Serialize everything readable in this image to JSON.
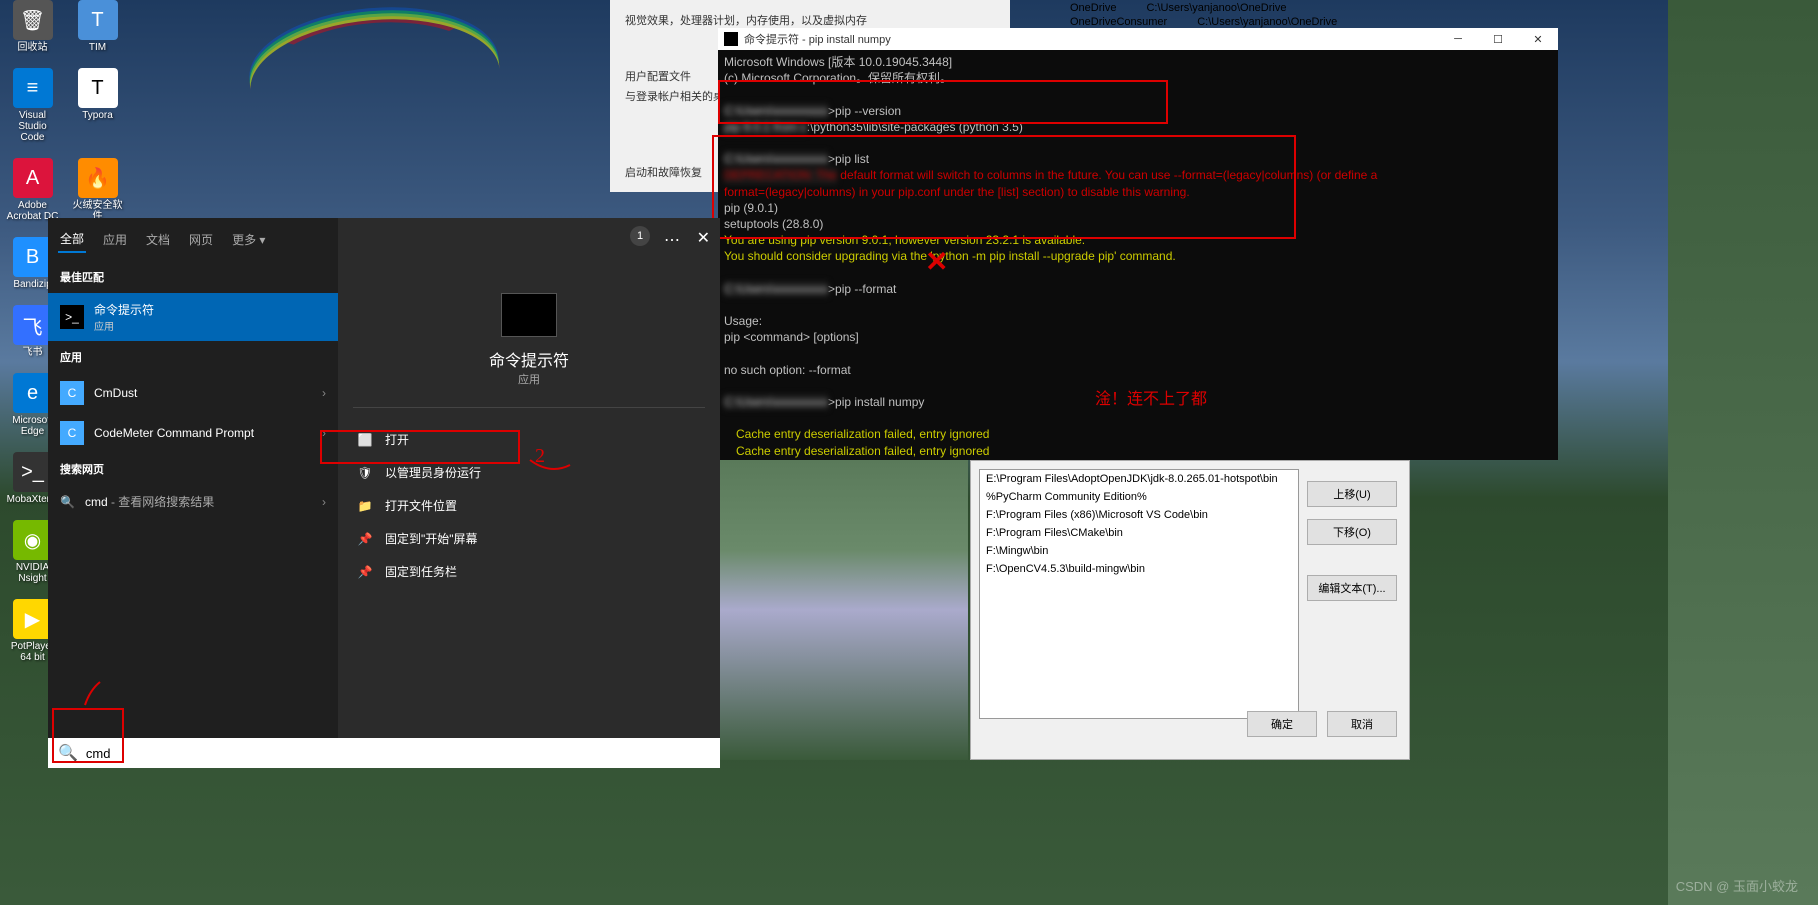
{
  "desktop": {
    "icons": [
      {
        "label": "回收站"
      },
      {
        "label": "TIM"
      },
      {
        "label": "Visual Studio Code"
      },
      {
        "label": "Typora"
      },
      {
        "label": "Adobe Acrobat DC"
      },
      {
        "label": "火绒安全软件"
      },
      {
        "label": "Bandizip"
      },
      {
        "label": ""
      },
      {
        "label": "飞书"
      },
      {
        "label": ""
      },
      {
        "label": "Microsoft Edge"
      },
      {
        "label": ""
      },
      {
        "label": "MobaXterm"
      },
      {
        "label": ""
      },
      {
        "label": "NVIDIA Nsight"
      },
      {
        "label": ""
      },
      {
        "label": "PotPlayer 64 bit"
      },
      {
        "label": ""
      }
    ]
  },
  "start_menu": {
    "tabs": {
      "all": "全部",
      "apps": "应用",
      "docs": "文档",
      "web": "网页",
      "more": "更多"
    },
    "badge": "1",
    "sections": {
      "best_match": "最佳匹配",
      "apps": "应用",
      "web": "搜索网页"
    },
    "best_item": {
      "title": "命令提示符",
      "sub": "应用"
    },
    "app_items": [
      {
        "title": "CmDust"
      },
      {
        "title": "CodeMeter Command Prompt"
      }
    ],
    "web_item": {
      "prefix": "cmd",
      "suffix": " - 查看网络搜索结果"
    },
    "preview": {
      "title": "命令提示符",
      "sub": "应用"
    },
    "actions": {
      "open": "打开",
      "admin": "以管理员身份运行",
      "location": "打开文件位置",
      "pin_start": "固定到\"开始\"屏幕",
      "pin_taskbar": "固定到任务栏"
    },
    "search_value": "cmd"
  },
  "sysprops": {
    "line1": "视觉效果，处理器计划，内存使用，以及虚拟内存",
    "line2": "用户配置文件",
    "line3": "与登录帐户相关的桌面设置",
    "line4": "启动和故障恢复"
  },
  "paths": {
    "rows": [
      {
        "name": "OneDrive",
        "value": "C:\\Users\\yanjanoo\\OneDrive"
      },
      {
        "name": "OneDriveConsumer",
        "value": "C:\\Users\\yanjanoo\\OneDrive"
      }
    ]
  },
  "cmd": {
    "title": "命令提示符 - pip  install numpy",
    "lines": {
      "l1": "Microsoft Windows [版本 10.0.19045.3448]",
      "l2": "(c) Microsoft Corporation。保留所有权利。",
      "l3": ">pip --version",
      "l4": ":\\python35\\lib\\site-packages (python 3.5)",
      "l5": ">pip list",
      "l6": "default format will switch to columns in the future. You can use --format=(legacy|columns) (or define a",
      "l7": "format=(legacy|columns) in your pip.conf under the [list] section) to disable this warning.",
      "l8": "pip (9.0.1)",
      "l9": "setuptools (28.8.0)",
      "l10": "You are using pip version 9.0.1, however version 23.2.1 is available.",
      "l11": "You should consider upgrading via the 'python -m pip install --upgrade pip' command.",
      "l12": ">pip --format",
      "l13": "Usage:",
      "l14": "  pip <command> [options]",
      "l15": "no such option: --format",
      "l16": ">pip install numpy",
      "l17": "Cache entry deserialization failed, entry ignored",
      "l18": "Cache entry deserialization failed, entry ignored"
    },
    "annotation": "淦！连不上了都"
  },
  "env": {
    "items": [
      "E:\\Program Files\\AdoptOpenJDK\\jdk-8.0.265.01-hotspot\\bin",
      "%PyCharm Community Edition%",
      "F:\\Program Files (x86)\\Microsoft VS Code\\bin",
      "F:\\Program Files\\CMake\\bin",
      "F:\\Mingw\\bin",
      "F:\\OpenCV4.5.3\\build-mingw\\bin"
    ],
    "buttons": {
      "up": "上移(U)",
      "down": "下移(O)",
      "edit": "编辑文本(T)...",
      "ok": "确定",
      "cancel": "取消"
    }
  },
  "annotations": {
    "num2": "2"
  },
  "watermark": "CSDN @ 玉面小蛟龙"
}
